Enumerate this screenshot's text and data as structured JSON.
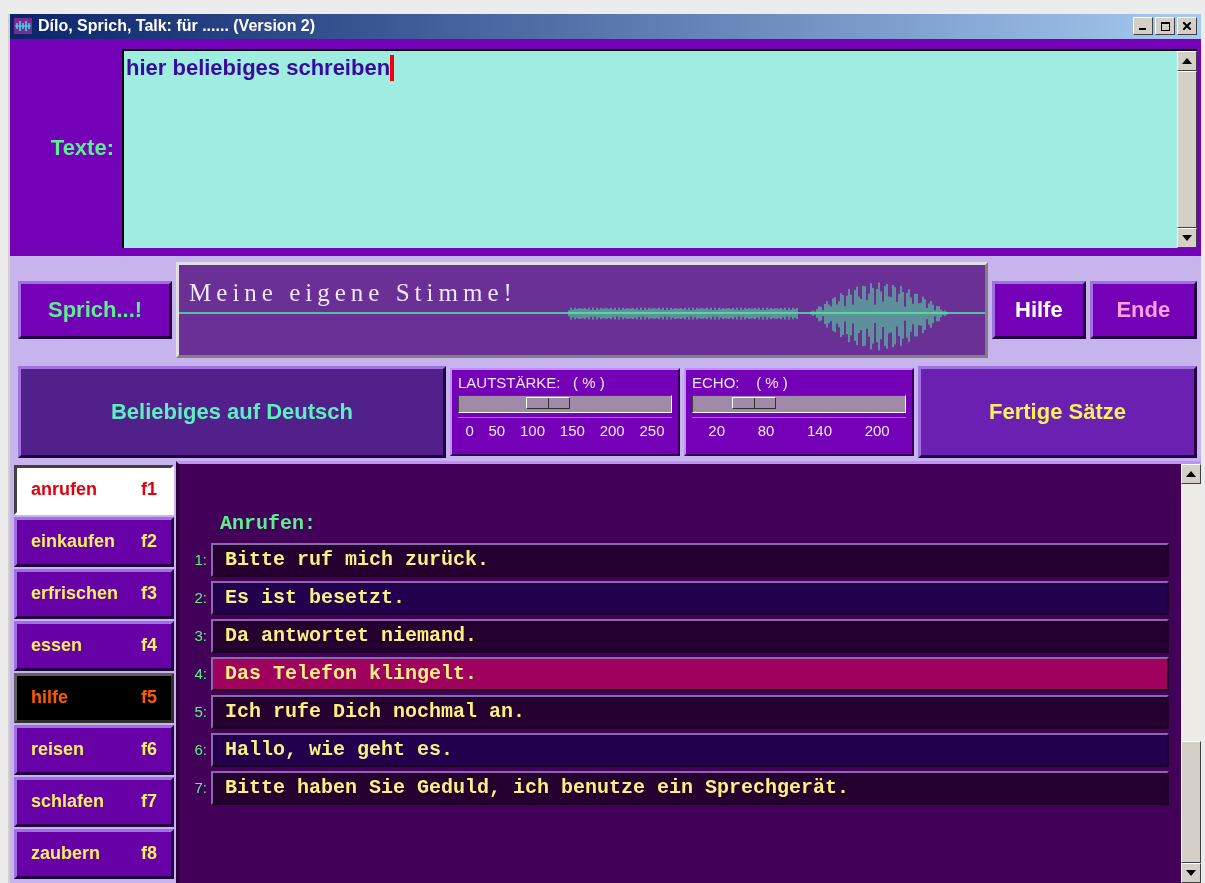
{
  "window": {
    "title": "Dílo, Sprich, Talk: für ...... (Version 2)"
  },
  "text_input": {
    "label": "Texte:",
    "value": "hier beliebiges schreiben"
  },
  "speak_button": "Sprich...!",
  "display": {
    "title": "Meine eigene Stimme!"
  },
  "help_button": "Hilfe",
  "end_button": "Ende",
  "free_text_button": "Beliebiges auf Deutsch",
  "volume": {
    "label": "LAUTSTÄRKE:   ( % )",
    "level": 0.42,
    "ticks": [
      "0",
      "50",
      "100",
      "150",
      "200",
      "250"
    ]
  },
  "echo": {
    "label": "ECHO:    ( % )",
    "level": 0.29,
    "ticks": [
      "20",
      "80",
      "140",
      "200"
    ]
  },
  "phrases_button": "Fertige Sätze",
  "categories": [
    {
      "label": "anrufen",
      "key": "f1",
      "kind": "topic",
      "selected": true
    },
    {
      "label": "einkaufen",
      "key": "f2",
      "kind": "topic",
      "selected": false
    },
    {
      "label": "erfrischen",
      "key": "f3",
      "kind": "topic",
      "selected": false
    },
    {
      "label": "essen",
      "key": "f4",
      "kind": "topic",
      "selected": false
    },
    {
      "label": "hilfe",
      "key": "f5",
      "kind": "help",
      "selected": false
    },
    {
      "label": "reisen",
      "key": "f6",
      "kind": "topic",
      "selected": false
    },
    {
      "label": "schlafen",
      "key": "f7",
      "kind": "topic",
      "selected": false
    },
    {
      "label": "zaubern",
      "key": "f8",
      "kind": "topic",
      "selected": false
    }
  ],
  "phrase_list": {
    "heading": "Anrufen:",
    "items": [
      {
        "number": "1:",
        "text": "Bitte ruf mich zurück.",
        "selected": false
      },
      {
        "number": "2:",
        "text": "Es ist besetzt.",
        "selected": false
      },
      {
        "number": "3:",
        "text": "Da antwortet niemand.",
        "selected": false
      },
      {
        "number": "4:",
        "text": "Das Telefon klingelt.",
        "selected": true
      },
      {
        "number": "5:",
        "text": "Ich rufe Dich nochmal an.",
        "selected": false
      },
      {
        "number": "6:",
        "text": "Hallo, wie geht es.",
        "selected": false
      },
      {
        "number": "7:",
        "text": "Bitte haben Sie Geduld, ich benutze ein Sprechgerät.",
        "selected": false
      }
    ]
  }
}
